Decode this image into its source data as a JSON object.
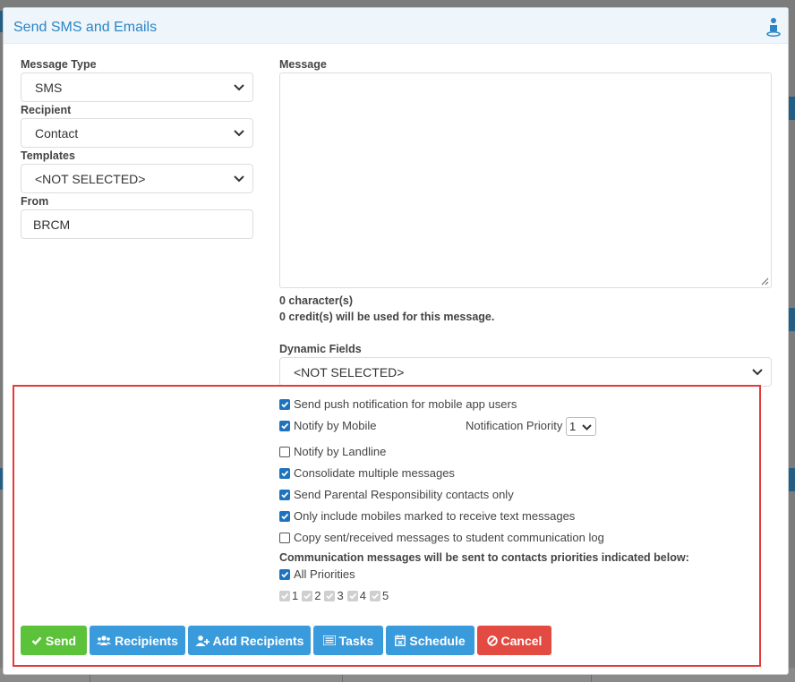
{
  "modal": {
    "title": "Send SMS and Emails"
  },
  "form": {
    "message_type": {
      "label": "Message Type",
      "value": "SMS"
    },
    "recipient": {
      "label": "Recipient",
      "value": "Contact"
    },
    "templates": {
      "label": "Templates",
      "value": "<NOT SELECTED>"
    },
    "from": {
      "label": "From",
      "value": "BRCM"
    },
    "message": {
      "label": "Message",
      "value": ""
    },
    "char_count": "0 character(s)",
    "credit_info": "0 credit(s) will be used for this message.",
    "dynamic_fields": {
      "label": "Dynamic Fields",
      "value": "<NOT SELECTED>"
    }
  },
  "options": [
    {
      "label": "Send push notification for mobile app users",
      "checked": true
    },
    {
      "label": "Notify by Mobile",
      "checked": true
    },
    {
      "label": "Notify by Landline",
      "checked": false
    },
    {
      "label": "Consolidate multiple messages",
      "checked": true
    },
    {
      "label": "Send Parental Responsibility contacts only",
      "checked": true
    },
    {
      "label": "Only include mobiles marked to receive text messages",
      "checked": true
    },
    {
      "label": "Copy sent/received messages to student communication log",
      "checked": false
    }
  ],
  "notification_priority": {
    "label": "Notification Priority",
    "value": "1"
  },
  "communication_note": "Communication messages will be sent to contacts priorities indicated below:",
  "all_priorities": {
    "label": "All Priorities",
    "checked": true
  },
  "priorities": [
    "1",
    "2",
    "3",
    "4",
    "5"
  ],
  "buttons": {
    "send": "Send",
    "recipients": "Recipients",
    "add_recipients": "Add Recipients",
    "tasks": "Tasks",
    "schedule": "Schedule",
    "cancel": "Cancel"
  },
  "colors": {
    "accent": "#2b86c5",
    "send": "#5cc23a",
    "primary": "#3a9bdc",
    "cancel": "#e34a41",
    "highlight_border": "#e53a3a",
    "checkbox": "#1e73be"
  }
}
